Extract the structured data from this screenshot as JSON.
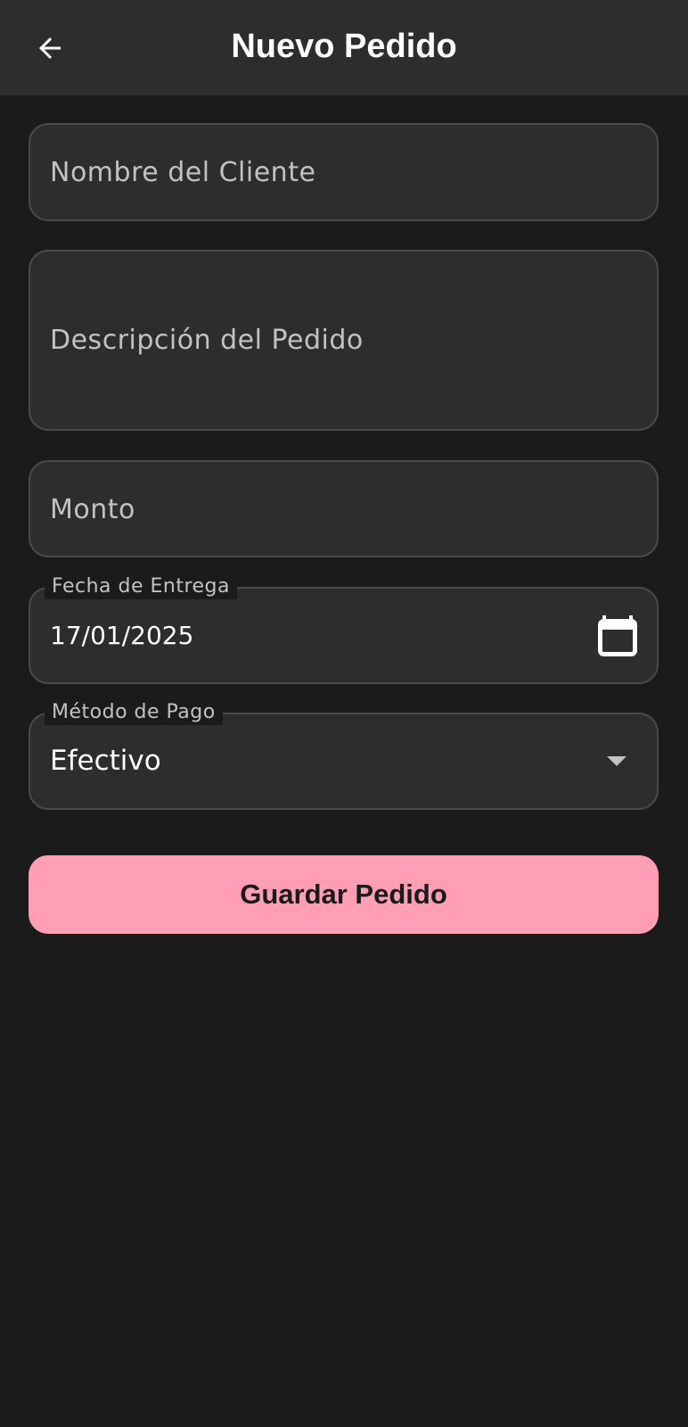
{
  "app_bar": {
    "title": "Nuevo Pedido",
    "back_icon": "arrow-back-icon"
  },
  "form": {
    "customer_name": {
      "placeholder": "Nombre del Cliente",
      "value": ""
    },
    "order_description": {
      "placeholder": "Descripción del Pedido",
      "value": ""
    },
    "amount": {
      "placeholder": "Monto",
      "value": ""
    },
    "delivery_date": {
      "label": "Fecha de Entrega",
      "value": "17/01/2025",
      "icon": "calendar-icon"
    },
    "payment_method": {
      "label": "Método de Pago",
      "selected": "Efectivo",
      "icon": "dropdown-arrow-icon"
    },
    "save_label": "Guardar Pedido"
  },
  "colors": {
    "background": "#1b1b1b",
    "surface": "#2d2d2d",
    "border": "#4a4a4a",
    "accent": "#ff9eb5",
    "placeholder_text": "#c2c2c2"
  }
}
